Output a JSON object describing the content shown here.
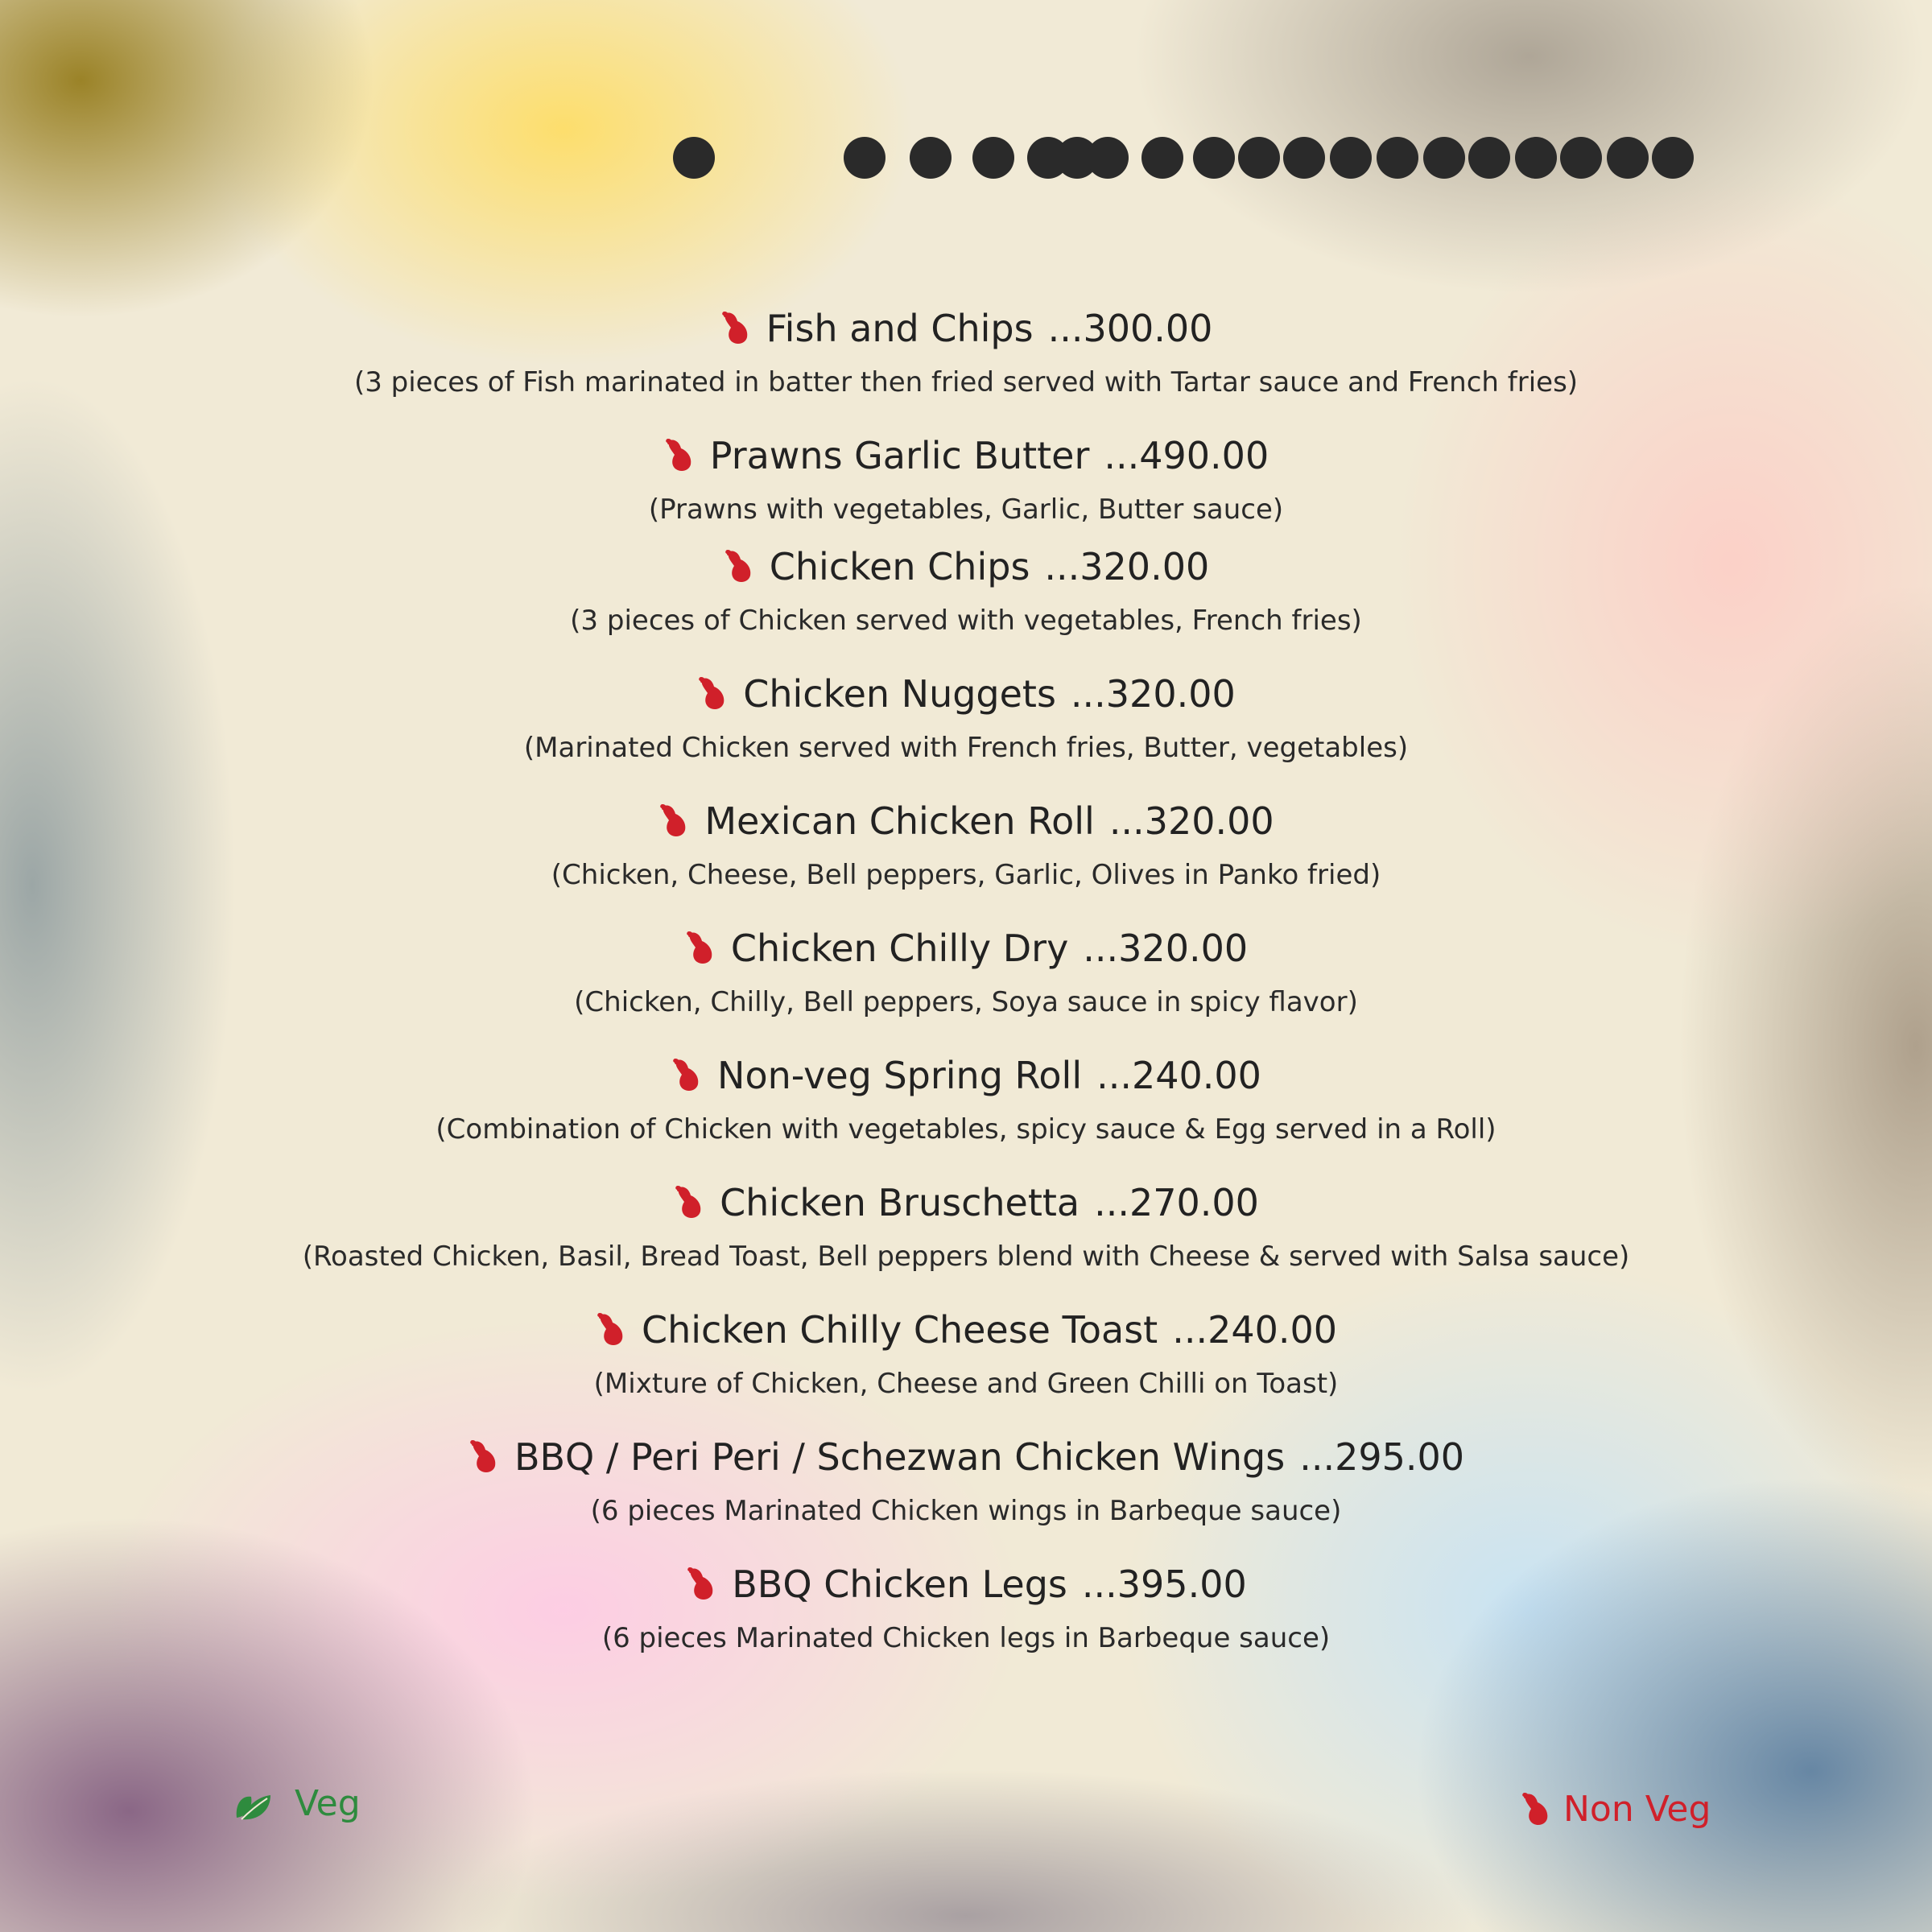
{
  "colors": {
    "veg": "#2e8b3e",
    "non_veg": "#d0202a",
    "text": "#222222"
  },
  "items": [
    {
      "name": "Fish and Chips",
      "price": "...300.00",
      "description": "(3 pieces of Fish marinated in batter then fried served with Tartar sauce and French fries)",
      "icon": "chicken-leg-icon"
    },
    {
      "name": "Prawns Garlic Butter",
      "price": "...490.00",
      "description": "(Prawns with vegetables, Garlic, Butter sauce)",
      "icon": "chicken-leg-icon"
    },
    {
      "name": "Chicken Chips",
      "price": "...320.00",
      "description": "(3 pieces of Chicken served with vegetables, French fries)",
      "icon": "chicken-leg-icon"
    },
    {
      "name": "Chicken Nuggets",
      "price": "...320.00",
      "description": "(Marinated Chicken served with French fries, Butter, vegetables)",
      "icon": "chicken-leg-icon"
    },
    {
      "name": "Mexican Chicken Roll",
      "price": "...320.00",
      "description": "(Chicken, Cheese, Bell peppers, Garlic, Olives in Panko fried)",
      "icon": "chicken-leg-icon"
    },
    {
      "name": "Chicken Chilly Dry",
      "price": "...320.00",
      "description": "(Chicken, Chilly, Bell peppers, Soya sauce in spicy flavor)",
      "icon": "chicken-leg-icon"
    },
    {
      "name": "Non-veg Spring Roll",
      "price": "...240.00",
      "description": "(Combination of Chicken with vegetables, spicy sauce & Egg served in a Roll)",
      "icon": "chicken-leg-icon"
    },
    {
      "name": "Chicken Bruschetta",
      "price": "...270.00",
      "description": "(Roasted Chicken, Basil, Bread Toast, Bell peppers blend with Cheese & served with Salsa sauce)",
      "icon": "chicken-leg-icon"
    },
    {
      "name": "Chicken Chilly Cheese Toast",
      "price": "...240.00",
      "description": "(Mixture of Chicken, Cheese and Green Chilli on Toast)",
      "icon": "chicken-leg-icon"
    },
    {
      "name": "BBQ / Peri Peri / Schezwan Chicken Wings",
      "price": "...295.00",
      "description": "(6 pieces Marinated Chicken wings in Barbeque sauce)",
      "icon": "chicken-leg-icon"
    },
    {
      "name": "BBQ Chicken Legs",
      "price": "...395.00",
      "description": "(6 pieces Marinated Chicken legs in Barbeque sauce)",
      "icon": "chicken-leg-icon"
    }
  ],
  "legend": {
    "veg_label": "Veg",
    "veg_icon": "leaf-icon",
    "non_veg_label": "Non Veg",
    "non_veg_icon": "chicken-leg-icon"
  }
}
